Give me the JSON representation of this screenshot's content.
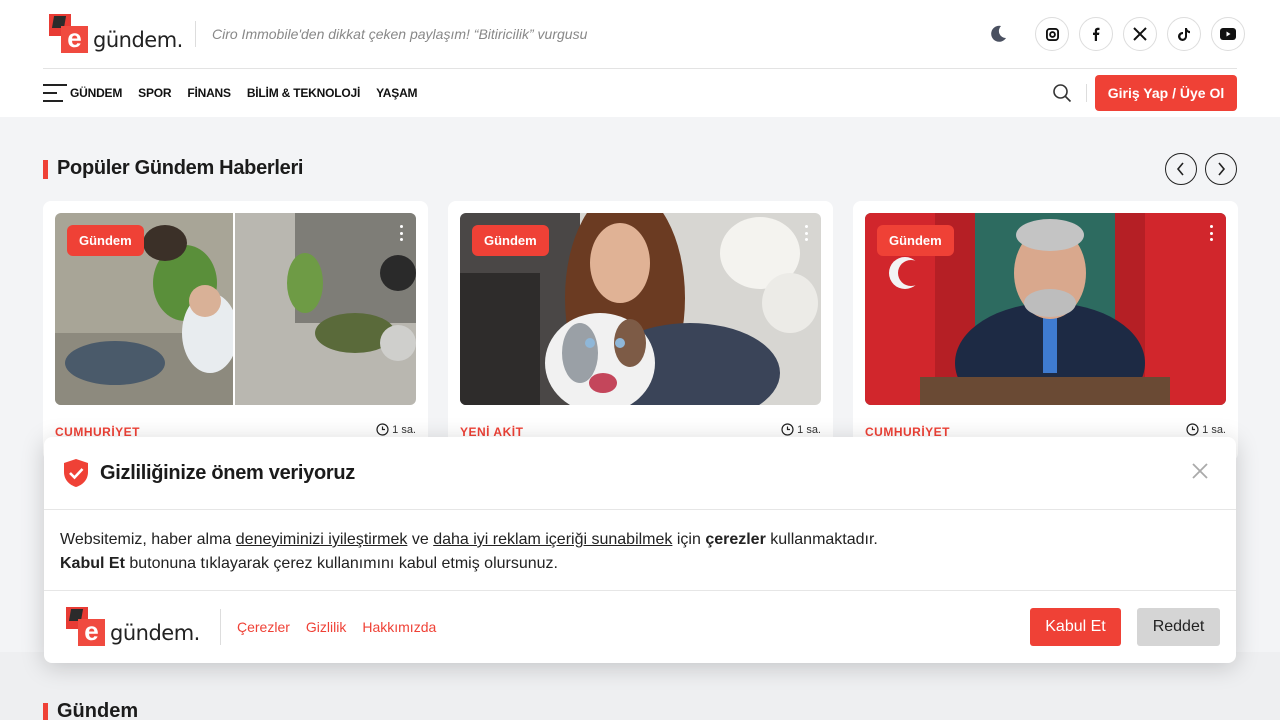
{
  "brand": {
    "mark_letter": "e",
    "name": "gündem.",
    "accent": "#ef4136"
  },
  "ticker": "Ciro Immobile'den dikkat çeken paylaşım! “Bitiricilik” vurgusu",
  "socials": [
    "instagram-icon",
    "facebook-icon",
    "x-icon",
    "tiktok-icon",
    "youtube-icon"
  ],
  "nav": {
    "items": [
      "GÜNDEM",
      "SPOR",
      "FİNANS",
      "BİLİM & TEKNOLOJİ",
      "YAŞAM"
    ],
    "login_label": "Giriş Yap / Üye Ol"
  },
  "popular": {
    "title": "Popüler Gündem Haberleri",
    "cards": [
      {
        "badge": "Gündem",
        "source": "CUMHURİYET",
        "time": "1 sa."
      },
      {
        "badge": "Gündem",
        "source": "YENİ AKİT",
        "time": "1 sa."
      },
      {
        "badge": "Gündem",
        "source": "CUMHURİYET",
        "time": "1 sa."
      }
    ]
  },
  "section2_title": "Gündem",
  "cookie": {
    "title": "Gizliliğinize önem veriyoruz",
    "line1_a": "Websitemiz, haber alma ",
    "line1_link1": "deneyiminizi iyileştirmek",
    "line1_b": " ve ",
    "line1_link2": "daha iyi reklam içeriği sunabilmek",
    "line1_c": " için ",
    "line1_bold": "çerezler",
    "line1_d": " kullanmaktadır.",
    "line2_bold": "Kabul Et",
    "line2_rest": " butonuna tıklayarak çerez kullanımını kabul etmiş olursunuz.",
    "links": [
      "Çerezler",
      "Gizlilik",
      "Hakkımızda"
    ],
    "accept_label": "Kabul Et",
    "reject_label": "Reddet"
  }
}
